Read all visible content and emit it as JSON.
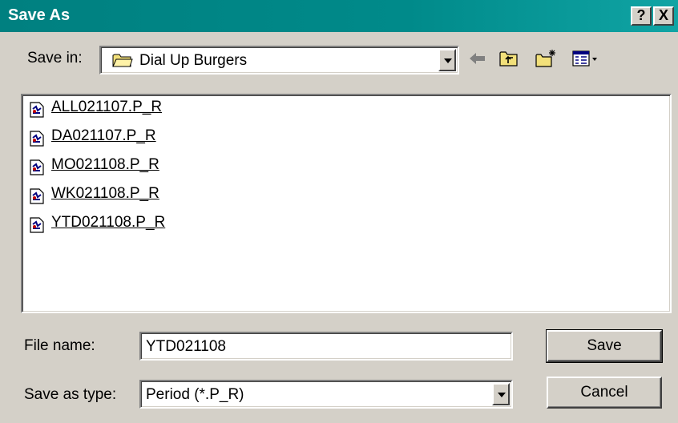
{
  "window": {
    "title": "Save As",
    "help_button": "?",
    "close_button": "X"
  },
  "toolbar": {
    "save_in_label": "Save in:",
    "save_in_value": "Dial Up Burgers",
    "icons": [
      "back-arrow-icon",
      "up-one-level-icon",
      "new-folder-icon",
      "view-menu-icon"
    ]
  },
  "files": [
    {
      "name": "ALL021107.P_R"
    },
    {
      "name": "DA021107.P_R"
    },
    {
      "name": "MO021108.P_R"
    },
    {
      "name": "WK021108.P_R"
    },
    {
      "name": "YTD021108.P_R"
    }
  ],
  "form": {
    "file_name_label": "File name:",
    "file_name_value": "YTD021108",
    "save_as_type_label": "Save as type:",
    "save_as_type_value": "Period (*.P_R)"
  },
  "buttons": {
    "save": "Save",
    "cancel": "Cancel"
  },
  "colors": {
    "titlebar": "#008080",
    "face": "#d4d0c8",
    "folder": "#f2e07a"
  }
}
